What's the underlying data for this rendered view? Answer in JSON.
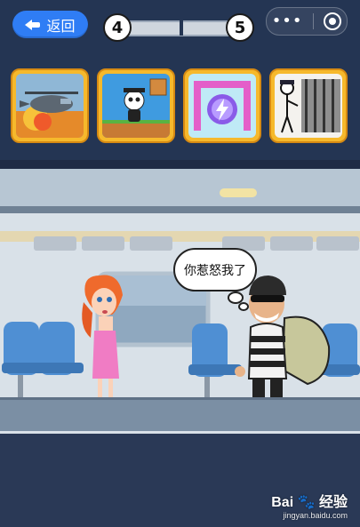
{
  "hud": {
    "back_label": "返回",
    "current_level": "4",
    "next_level": "5",
    "menu_icon": "more-dots-icon",
    "close_icon": "target-close-icon"
  },
  "promo_games": [
    {
      "name": "helicopter-game-icon"
    },
    {
      "name": "panda-game-icon"
    },
    {
      "name": "lightning-orb-game-icon"
    },
    {
      "name": "prison-stickman-game-icon"
    }
  ],
  "scene": {
    "speech_bubble": "你惹怒我了"
  },
  "watermark": {
    "brand": "Bai",
    "brand_suffix": "经验",
    "url": "jingyan.baidu.com"
  },
  "colors": {
    "accent": "#2f7df5",
    "tile_border": "#f6b92c",
    "panel": "#243553"
  }
}
